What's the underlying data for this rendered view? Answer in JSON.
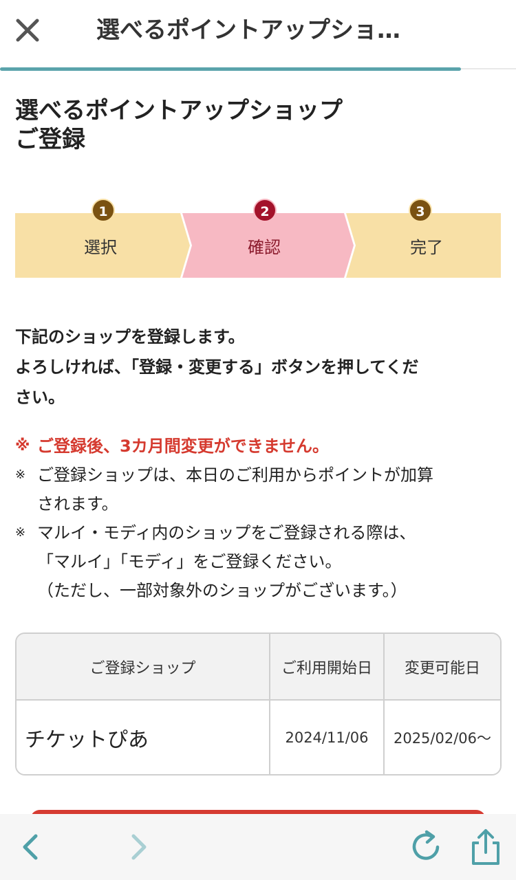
{
  "header": {
    "title": "選べるポイントアップショ…",
    "close_icon": "close-icon"
  },
  "page": {
    "heading_line1": "選べるポイントアップショップ",
    "heading_line2": "ご登録"
  },
  "steps": [
    {
      "num": "1",
      "label": "選択",
      "state": "done"
    },
    {
      "num": "2",
      "label": "確認",
      "state": "current"
    },
    {
      "num": "3",
      "label": "完了",
      "state": "pending"
    }
  ],
  "intro": {
    "line1": "下記のショップを登録します。",
    "line2": "よろしければ、「登録・変更する」ボタンを押してくだ",
    "line3": "さい。"
  },
  "notes": {
    "mark": "※",
    "warning": "ご登録後、3カ月間変更ができません。",
    "note1_line1": "ご登録ショップは、本日のご利用からポイントが加算",
    "note1_line2": "されます。",
    "note2_line1": "マルイ・モディ内のショップをご登録される際は、",
    "note2_line2": "「マルイ」「モディ」をご登録ください。",
    "note2_line3": "（ただし、一部対象外のショップがございます。）"
  },
  "table": {
    "headers": [
      "ご登録ショップ",
      "ご利用開始日",
      "変更可能日"
    ],
    "rows": [
      [
        "チケットぴあ",
        "2024/11/06",
        "2025/02/06〜"
      ]
    ]
  },
  "bottom_bar": {
    "icons": [
      "back-icon",
      "forward-icon",
      "reload-icon",
      "share-icon"
    ]
  },
  "colors": {
    "accent": "#5aa3ab",
    "warning": "#d53a2f",
    "step_done": "#f8e0a6",
    "step_current": "#f7b9c3",
    "step_badge_brown": "#7a5212",
    "step_badge_red": "#a3122a"
  }
}
